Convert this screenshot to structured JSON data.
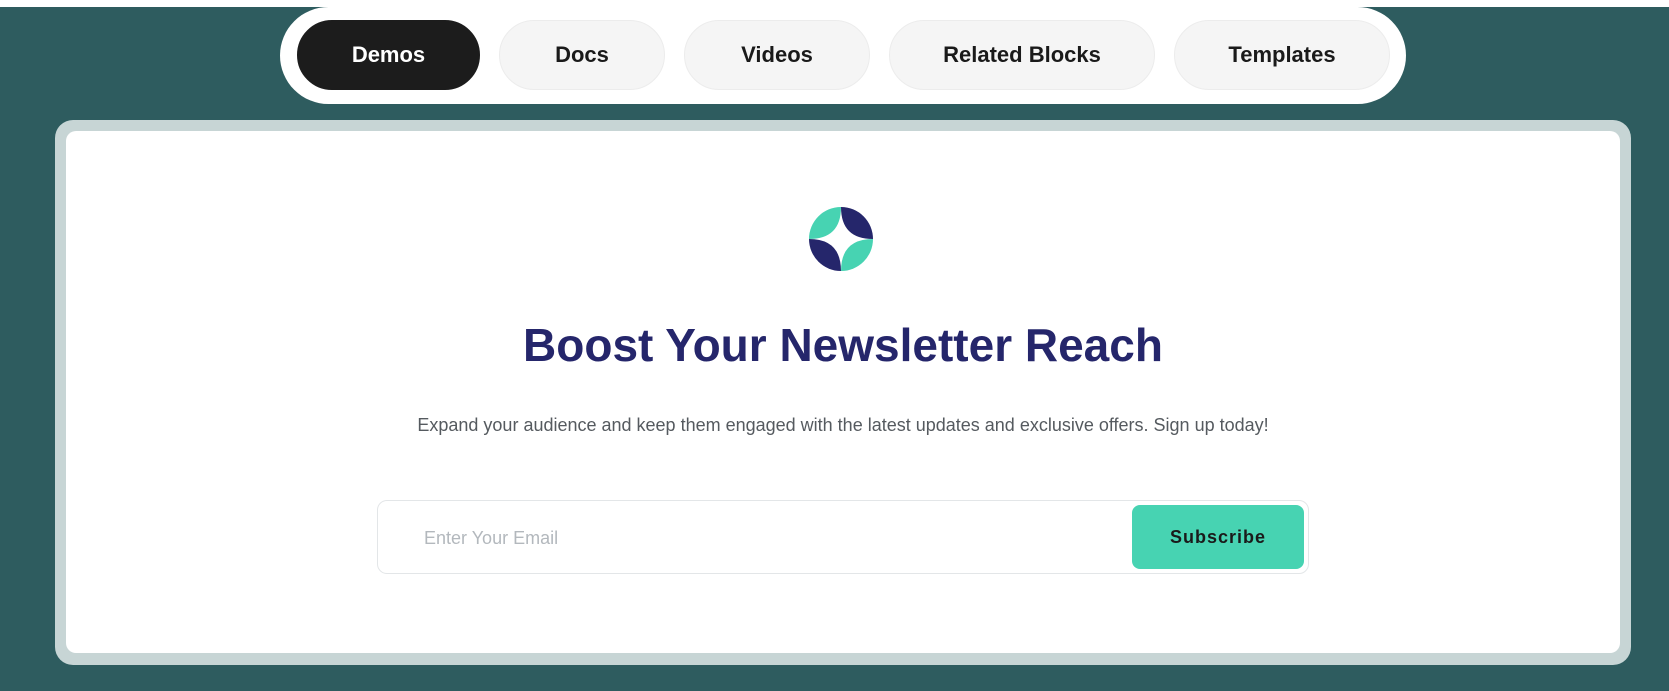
{
  "nav": {
    "tabs": [
      {
        "label": "Demos",
        "active": true
      },
      {
        "label": "Docs",
        "active": false
      },
      {
        "label": "Videos",
        "active": false
      },
      {
        "label": "Related Blocks",
        "active": false
      },
      {
        "label": "Templates",
        "active": false
      }
    ]
  },
  "hero": {
    "logo_icon": "four-point-star-logo-icon",
    "headline": "Boost Your Newsletter Reach",
    "subtext": "Expand your audience and keep them engaged with the latest updates and exclusive offers. Sign up today!"
  },
  "form": {
    "email_placeholder": "Enter Your Email",
    "email_value": "",
    "subscribe_label": "Subscribe"
  },
  "colors": {
    "background": "#2e5c5f",
    "headline": "#25266b",
    "accent": "#47d3b2",
    "active_tab": "#1c1c1c"
  }
}
